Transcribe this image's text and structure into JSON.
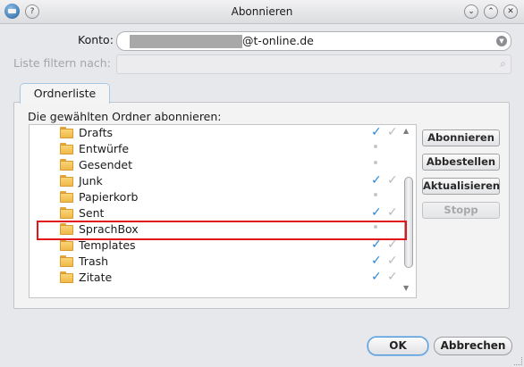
{
  "window": {
    "title": "Abonnieren",
    "buttons": {
      "help": "?",
      "minimize": "⌄",
      "maximize": "⌃",
      "close": "✕"
    }
  },
  "account": {
    "label": "Konto:",
    "value_suffix": "@t-online.de"
  },
  "filter": {
    "label": "Liste filtern nach:",
    "placeholder": ""
  },
  "tabs": [
    {
      "label": "Ordnerliste"
    }
  ],
  "list": {
    "heading": "Die gewählten Ordner abonnieren:",
    "folders": [
      {
        "name": "Drafts",
        "subscribed": true
      },
      {
        "name": "Entwürfe",
        "subscribed": false
      },
      {
        "name": "Gesendet",
        "subscribed": false
      },
      {
        "name": "Junk",
        "subscribed": true
      },
      {
        "name": "Papierkorb",
        "subscribed": false
      },
      {
        "name": "Sent",
        "subscribed": true
      },
      {
        "name": "SprachBox",
        "subscribed": false
      },
      {
        "name": "Templates",
        "subscribed": true
      },
      {
        "name": "Trash",
        "subscribed": true
      },
      {
        "name": "Zitate",
        "subscribed": true
      }
    ],
    "highlighted_folder": "SprachBox"
  },
  "actions": {
    "subscribe": "Abonnieren",
    "unsubscribe": "Abbestellen",
    "refresh": "Aktualisieren",
    "stop": "Stopp"
  },
  "footer": {
    "ok": "OK",
    "cancel": "Abbrechen"
  },
  "colors": {
    "accent": "#2e86d6",
    "highlight_border": "#e0161b",
    "folder": "#f0b545"
  }
}
